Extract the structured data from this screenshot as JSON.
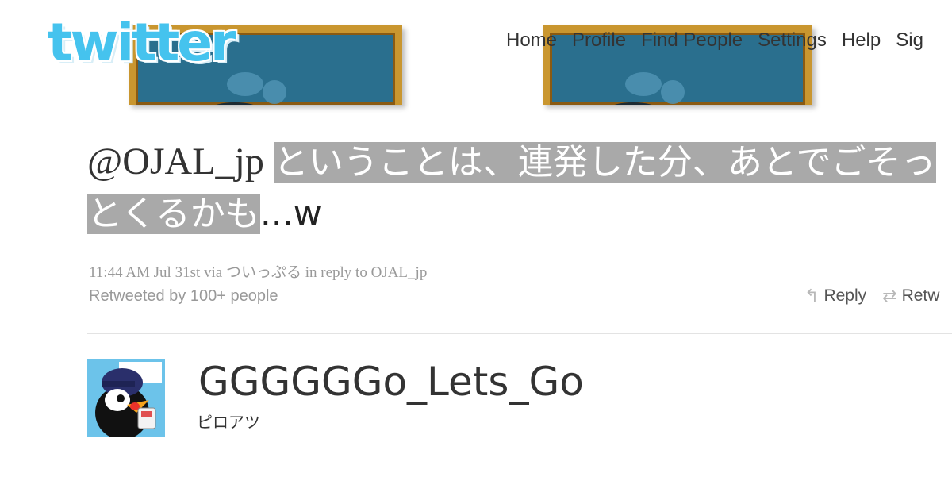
{
  "header": {
    "logo_text": "twitter",
    "logo_color": "#45c3ee",
    "nav": [
      "Home",
      "Profile",
      "Find People",
      "Settings",
      "Help",
      "Sig"
    ]
  },
  "tweet": {
    "mention": "@OJAL_jp",
    "highlighted_text": "ということは、連発した分、あとでごそっとくるかも",
    "tail_text": "...w",
    "timestamp": "11:44 AM Jul 31st",
    "via_label": "via",
    "client": "ついっぷる",
    "in_reply_label": "in reply to",
    "reply_to": "OJAL_jp",
    "retweeted_by": "Retweeted by 100+ people",
    "actions": {
      "reply_label": "Reply",
      "retweet_label": "Retw"
    },
    "highlight_color": "#a9a9a9"
  },
  "user": {
    "screen_name": "GGGGGGo_Lets_Go",
    "full_name": "ピロアツ",
    "avatar_icon": "penguin-avatar-icon"
  }
}
